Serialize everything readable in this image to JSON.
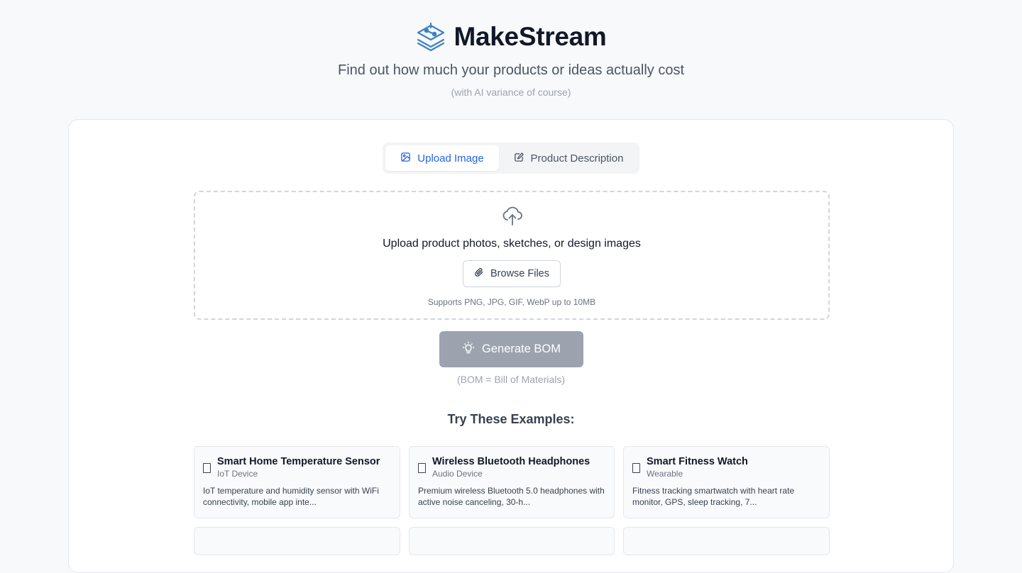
{
  "header": {
    "brand": "MakeStream",
    "logo_icon": "layers-stream-icon",
    "tagline": "Find out how much your products or ideas actually cost",
    "subtagline": "(with AI variance of course)"
  },
  "tabs": [
    {
      "label": "Upload Image",
      "icon": "image-icon",
      "active": true
    },
    {
      "label": "Product Description",
      "icon": "edit-icon",
      "active": false
    }
  ],
  "upload": {
    "icon": "cloud-upload-icon",
    "title": "Upload product photos, sketches, or design images",
    "browse_label": "Browse Files",
    "browse_icon": "paperclip-icon",
    "supports": "Supports PNG, JPG, GIF, WebP up to 10MB"
  },
  "generate": {
    "label": "Generate BOM",
    "icon": "lightbulb-icon",
    "note": "(BOM = Bill of Materials)"
  },
  "examples": {
    "title": "Try These Examples:",
    "items": [
      {
        "name": "Smart Home Temperature Sensor",
        "category": "IoT Device",
        "description": "IoT temperature and humidity sensor with WiFi connectivity, mobile app inte..."
      },
      {
        "name": "Wireless Bluetooth Headphones",
        "category": "Audio Device",
        "description": "Premium wireless Bluetooth 5.0 headphones with active noise canceling, 30-h..."
      },
      {
        "name": "Smart Fitness Watch",
        "category": "Wearable",
        "description": "Fitness tracking smartwatch with heart rate monitor, GPS, sleep tracking, 7..."
      }
    ]
  },
  "colors": {
    "accent": "#2563eb",
    "logo": "#3b82c4",
    "button_disabled": "#9ca3af",
    "background": "#f8f9fb"
  }
}
